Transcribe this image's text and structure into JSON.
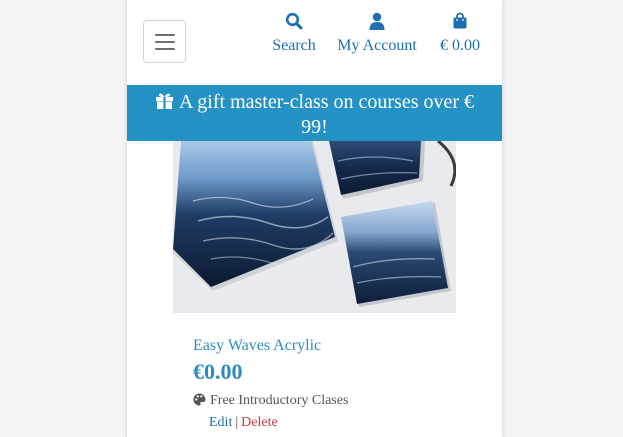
{
  "header": {
    "menu_toggle": "menu",
    "search_label": "Search",
    "account_label": "My Account",
    "bag_total": "€ 0.00"
  },
  "banner": {
    "text": "A gift master-class on courses over € 99!",
    "icon": "gift-icon"
  },
  "product": {
    "title": "Easy Waves Acrylic",
    "price": "€0.00",
    "category": "Free Introductory Clases",
    "category_icon": "palette-icon",
    "image_alt": "Three acrylic paintings of dark blue ocean waves",
    "edit_label": "Edit",
    "separator": "|",
    "delete_label": "Delete"
  },
  "colors": {
    "accent": "#1d6fb2",
    "banner_bg": "#2592c5",
    "product_text": "#2b8dbd",
    "delete": "#d43a3a"
  }
}
